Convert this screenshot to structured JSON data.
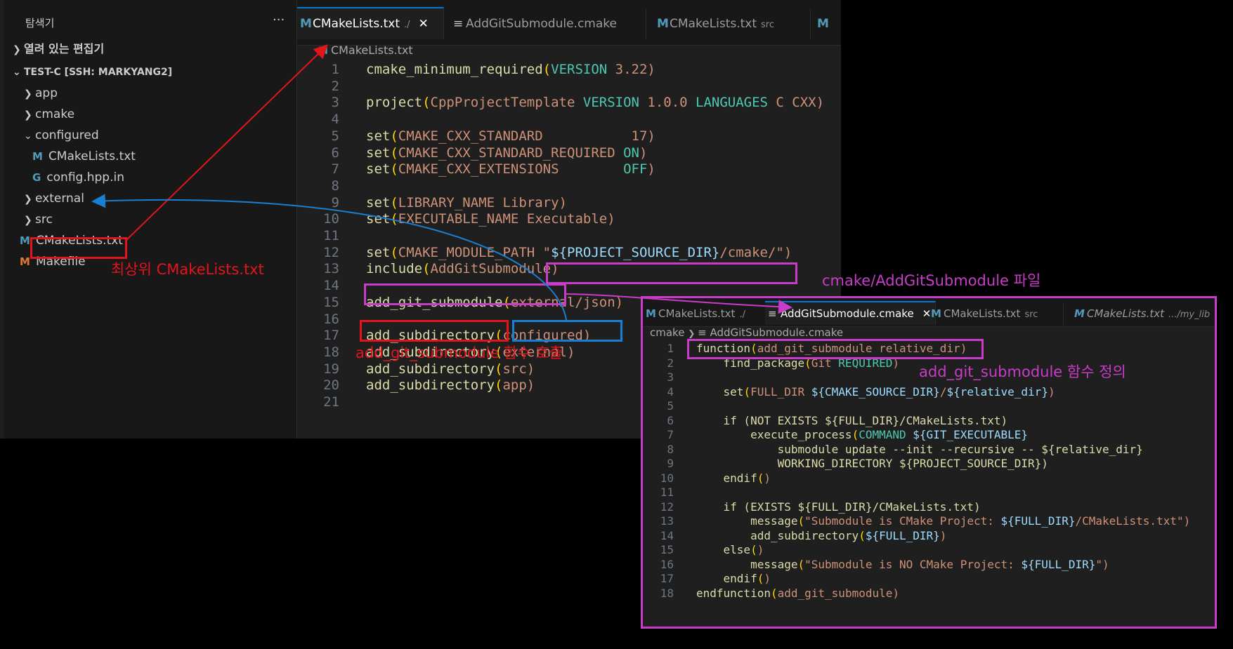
{
  "explorer": {
    "title": "탐색기",
    "more": "···",
    "open_editors": "열려 있는 편집기",
    "workspace": "TEST-C [SSH: MARKYANG2]",
    "items": [
      {
        "label": "app"
      },
      {
        "label": "cmake"
      },
      {
        "label": "configured"
      },
      {
        "label": "CMakeLists.txt"
      },
      {
        "label": "config.hpp.in"
      },
      {
        "label": "external"
      },
      {
        "label": "src"
      },
      {
        "label": "CMakeLists.txt"
      },
      {
        "label": "Makefile"
      }
    ]
  },
  "editor1": {
    "tabs": [
      {
        "label": "CMakeLists.txt",
        "suffix": "./",
        "close": "✕"
      },
      {
        "label": "AddGitSubmodule.cmake"
      },
      {
        "label": "CMakeLists.txt",
        "suffix": "src"
      },
      {
        "label": "M"
      }
    ],
    "breadcrumb": "CMakeLists.txt",
    "line_numbers": [
      "1",
      "2",
      "3",
      "4",
      "5",
      "6",
      "7",
      "8",
      "9",
      "10",
      "11",
      "12",
      "13",
      "14",
      "15",
      "16",
      "17",
      "18",
      "19",
      "20",
      "21"
    ],
    "lines": [
      "cmake_minimum_required(VERSION 3.22)",
      "",
      "project(CppProjectTemplate VERSION 1.0.0 LANGUAGES C CXX)",
      "",
      "set(CMAKE_CXX_STANDARD           17)",
      "set(CMAKE_CXX_STANDARD_REQUIRED ON)",
      "set(CMAKE_CXX_EXTENSIONS        OFF)",
      "",
      "set(LIBRARY_NAME Library)",
      "set(EXECUTABLE_NAME Executable)",
      "",
      "set(CMAKE_MODULE_PATH \"${PROJECT_SOURCE_DIR}/cmake/\")",
      "include(AddGitSubmodule)",
      "",
      "add_git_submodule(external/json)",
      "",
      "add_subdirectory(configured)",
      "add_subdirectory(external)",
      "add_subdirectory(src)",
      "add_subdirectory(app)",
      ""
    ]
  },
  "editor2": {
    "tabs": [
      {
        "label": "CMakeLists.txt",
        "suffix": "./"
      },
      {
        "label": "AddGitSubmodule.cmake",
        "close": "✕"
      },
      {
        "label": "CMakeLists.txt",
        "suffix": "src"
      },
      {
        "label": "CMakeLists.txt",
        "suffix": ".../my_lib"
      }
    ],
    "breadcrumb_folder": "cmake",
    "breadcrumb_file": "AddGitSubmodule.cmake",
    "line_numbers": [
      "1",
      "2",
      "3",
      "4",
      "5",
      "6",
      "7",
      "8",
      "9",
      "10",
      "11",
      "12",
      "13",
      "14",
      "15",
      "16",
      "17",
      "18"
    ],
    "lines": [
      "function(add_git_submodule relative_dir)",
      "    find_package(Git REQUIRED)",
      "",
      "    set(FULL_DIR ${CMAKE_SOURCE_DIR}/${relative_dir})",
      "",
      "    if (NOT EXISTS ${FULL_DIR}/CMakeLists.txt)",
      "        execute_process(COMMAND ${GIT_EXECUTABLE}",
      "            submodule update --init --recursive -- ${relative_dir}",
      "            WORKING_DIRECTORY ${PROJECT_SOURCE_DIR})",
      "    endif()",
      "",
      "    if (EXISTS ${FULL_DIR}/CMakeLists.txt)",
      "        message(\"Submodule is CMake Project: ${FULL_DIR}/CMakeLists.txt\")",
      "        add_subdirectory(${FULL_DIR})",
      "    else()",
      "        message(\"Submodule is NO CMake Project: ${FULL_DIR}\")",
      "    endif()",
      "endfunction(add_git_submodule)"
    ]
  },
  "annotations": {
    "top_cmake": "최상위 CMakeLists.txt",
    "call": "add_git_submodule 함수 호출",
    "file": "cmake/AddGitSubmodule 파일",
    "definition": "add_git_submodule 함수 정의"
  },
  "colors": {
    "red": "#e4141b",
    "blue": "#1a7fd1",
    "magenta": "#c83cc8",
    "function": "#dcdcaa",
    "argument": "#ce9178",
    "keyword": "#4ec9b0",
    "variable": "#9cdcfe"
  }
}
